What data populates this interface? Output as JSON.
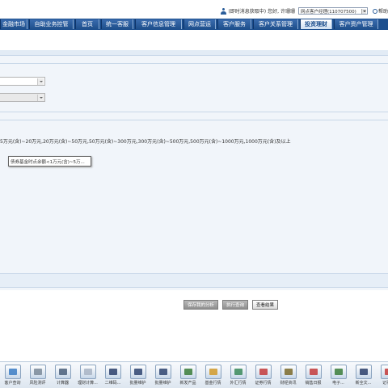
{
  "header": {
    "notice": "(即时消息获取中)",
    "greeting": "您好, 许珊珊",
    "role": "网点客户经理(110707500)",
    "help": "帮助"
  },
  "nav": {
    "items": [
      {
        "label": "金融市场",
        "width": 34,
        "active": false
      },
      {
        "label": "自助业务控管",
        "width": 55,
        "active": false
      },
      {
        "label": "首页",
        "width": 30,
        "active": false
      },
      {
        "label": "统一客服",
        "width": 40,
        "active": false
      },
      {
        "label": "客户信息管理",
        "width": 58,
        "active": false
      },
      {
        "label": "网点营运",
        "width": 40,
        "active": false
      },
      {
        "label": "客户服务",
        "width": 42,
        "active": false
      },
      {
        "label": "客户关系管理",
        "width": 56,
        "active": false
      },
      {
        "label": "投资理财",
        "width": 40,
        "active": true
      },
      {
        "label": "客户资产管理",
        "width": 55,
        "active": false
      }
    ]
  },
  "form": {
    "range_text": "5万元(含)~20万元,20万元(含)~50万元,50万元(含)~300万元,300万元(含)~500万元,500万元(含)~1000万元,1000万元(含)及以上",
    "tooltip": "债券基金时点余额<1万元(含)~5万..."
  },
  "actions": {
    "save": "保存我的分析",
    "run": "执行查询",
    "view": "查看结果"
  },
  "toolbar": {
    "items": [
      {
        "label": "客户查询",
        "icon": "customer-query-icon",
        "color": "#3b7cc4"
      },
      {
        "label": "风险测评",
        "icon": "risk-assessment-icon",
        "color": "#7a8a99"
      },
      {
        "label": "计算器",
        "icon": "calculator-icon",
        "color": "#4a5f7a"
      },
      {
        "label": "理财计算...",
        "icon": "finance-calc-icon",
        "color": "#a8b4c4"
      },
      {
        "label": "二维码...",
        "icon": "qr-code-icon",
        "color": "#2b3f6b"
      },
      {
        "label": "批量维护",
        "icon": "batch-maintain-icon",
        "color": "#2e4470"
      },
      {
        "label": "批量维护",
        "icon": "batch-maintain-icon-2",
        "color": "#2e4470"
      },
      {
        "label": "新发产品",
        "icon": "new-product-icon",
        "color": "#3a7c3a"
      },
      {
        "label": "基金行情",
        "icon": "fund-quote-icon",
        "color": "#d19a2a"
      },
      {
        "label": "外汇行情",
        "icon": "forex-quote-icon",
        "color": "#3a8a5a"
      },
      {
        "label": "证券行情",
        "icon": "stock-quote-icon",
        "color": "#c33a3a"
      },
      {
        "label": "财经资讯",
        "icon": "finance-news-icon",
        "color": "#7a6a2a"
      },
      {
        "label": "销售日报",
        "icon": "sales-report-icon",
        "color": "#c33a3a"
      },
      {
        "label": "电子...",
        "icon": "electronic-icon",
        "color": "#3a7c3a"
      },
      {
        "label": "新全文...",
        "icon": "fulltext-icon",
        "color": "#2b3f6b"
      },
      {
        "label": "记事本",
        "icon": "notepad-icon",
        "color": "#c33a3a"
      }
    ]
  }
}
